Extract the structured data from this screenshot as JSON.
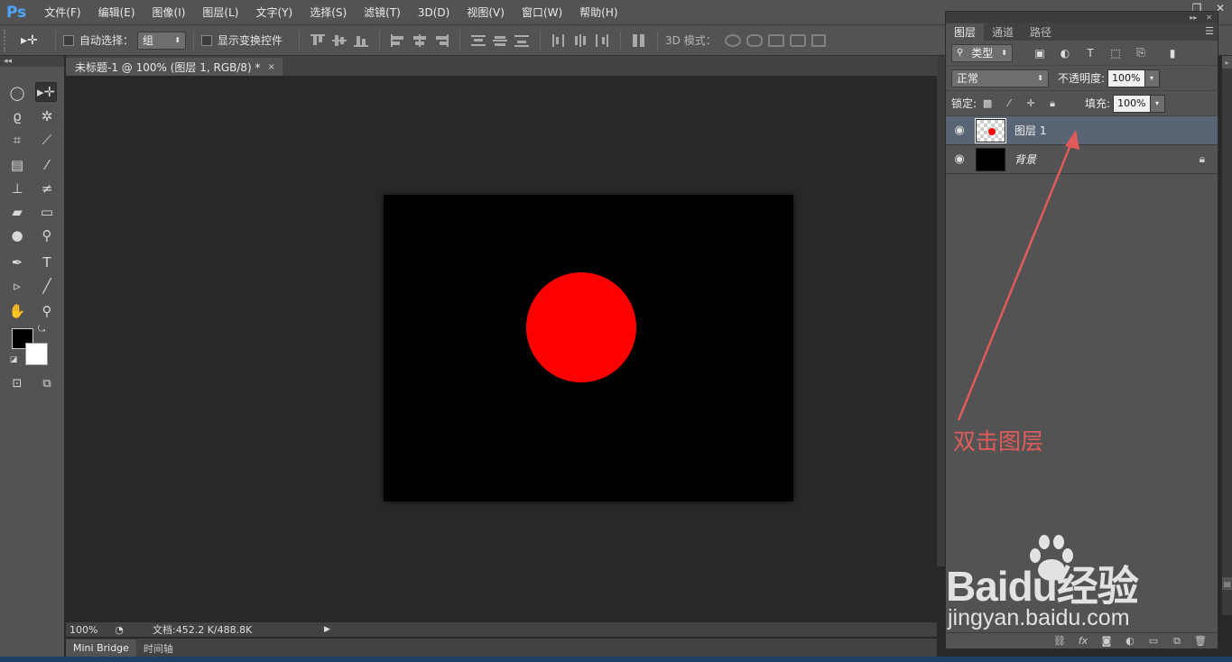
{
  "app": {
    "logo": "Ps",
    "menu": [
      "文件(F)",
      "编辑(E)",
      "图像(I)",
      "图层(L)",
      "文字(Y)",
      "选择(S)",
      "滤镜(T)",
      "3D(D)",
      "视图(V)",
      "窗口(W)",
      "帮助(H)"
    ]
  },
  "options": {
    "auto_select_label": "自动选择：",
    "auto_select_value": "组",
    "show_transform_label": "显示变换控件",
    "mode_3d_label": "3D 模式："
  },
  "document": {
    "tab_title": "未标题-1 @ 100% (图层 1, RGB/8) *",
    "tab_close": "×",
    "zoom": "100%",
    "doc_info": "文档:452.2 K/488.8K",
    "canvas_color": "#000000",
    "shape_color": "#ff0000"
  },
  "bottom_tabs": [
    "Mini Bridge",
    "时间轴"
  ],
  "layers_panel": {
    "tabs": [
      "图层",
      "通道",
      "路径"
    ],
    "filter_label": "类型",
    "blend_mode": "正常",
    "opacity_label": "不透明度:",
    "opacity_value": "100%",
    "lock_label": "锁定:",
    "fill_label": "填充:",
    "fill_value": "100%",
    "layers": [
      {
        "name": "图层 1",
        "selected": true
      },
      {
        "name": "背景",
        "selected": false,
        "locked": true
      }
    ]
  },
  "annotation": {
    "text": "双击图层",
    "color": "#e05c5c"
  },
  "watermark": {
    "brand": "Baidu经验",
    "url": "jingyan.baidu.com"
  },
  "colors": {
    "ui_bg": "#535353",
    "workspace": "#282828",
    "selected_layer": "#596475",
    "ps_blue": "#4ea3ff"
  }
}
